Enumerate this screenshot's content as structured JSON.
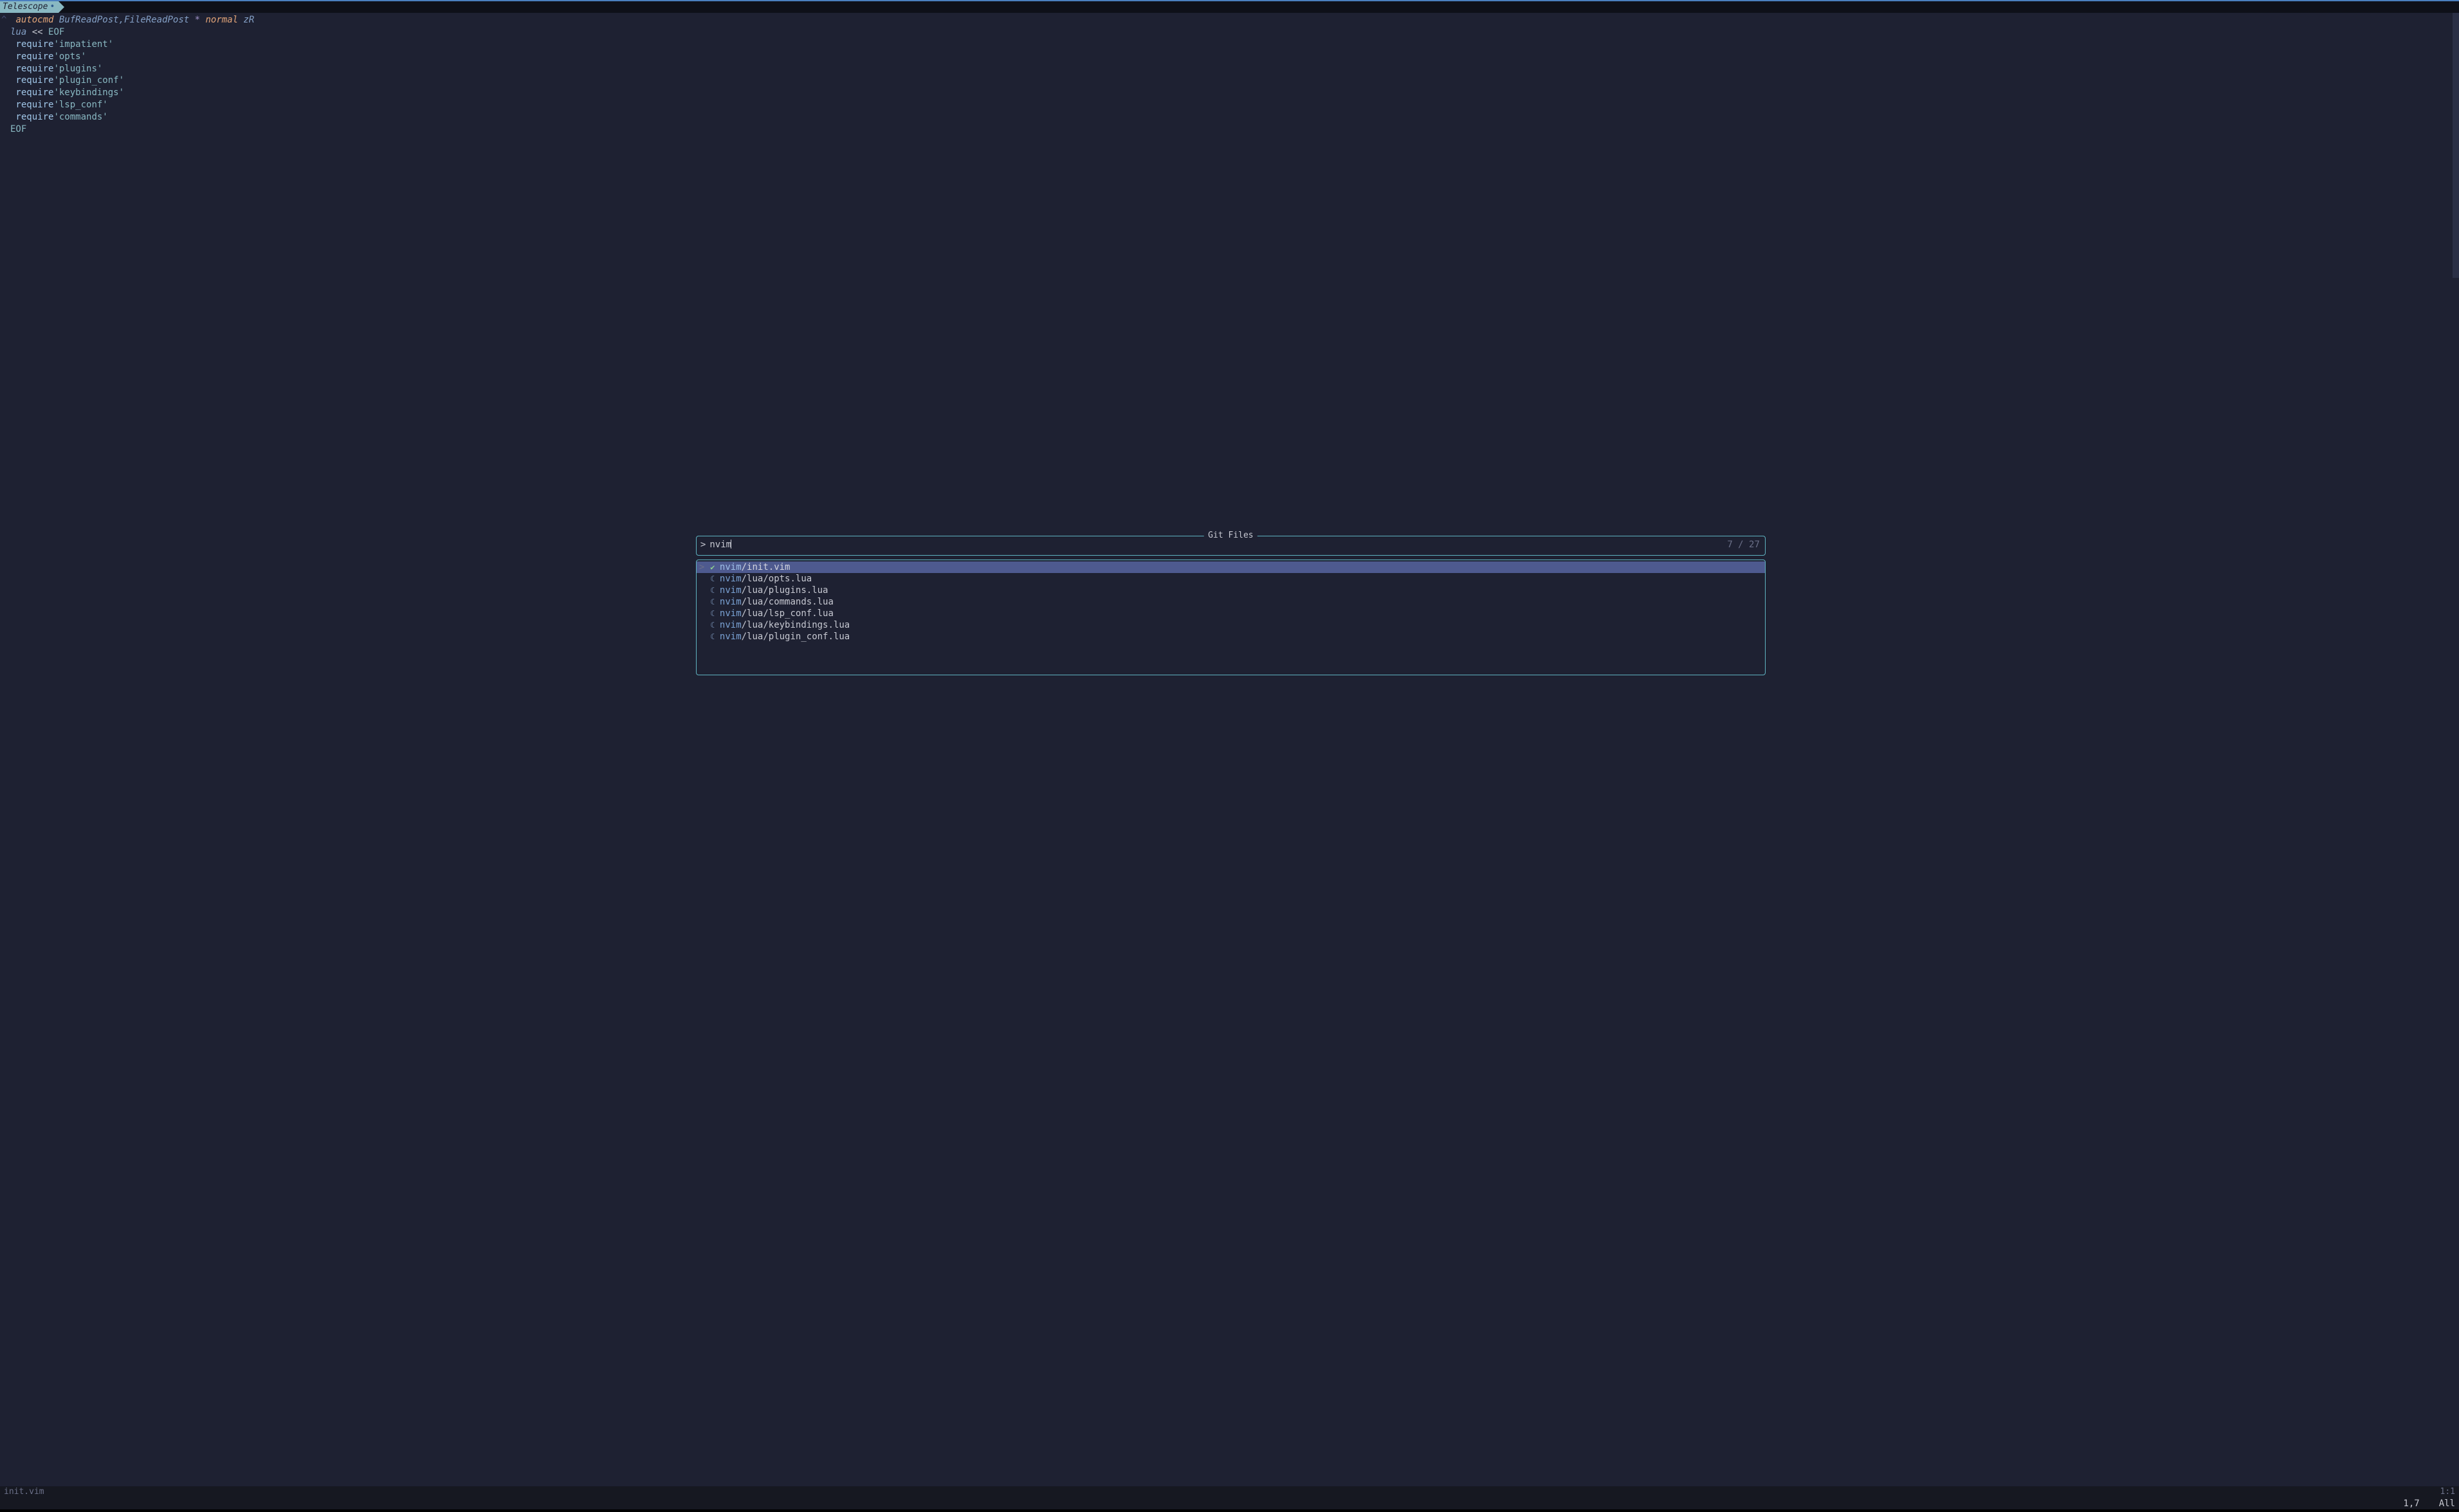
{
  "tabline": {
    "tabs": [
      {
        "label": "Telescope",
        "modified_mark": "•"
      }
    ]
  },
  "buffer": {
    "lines": [
      {
        "gutter": "^",
        "segments": [
          {
            "t": " ",
            "c": ""
          },
          {
            "t": "autocmd",
            "c": "kw-orange"
          },
          {
            "t": " BufReadPost,FileReadPost ",
            "c": "kw-blue"
          },
          {
            "t": "*",
            "c": "const"
          },
          {
            "t": " ",
            "c": ""
          },
          {
            "t": "normal",
            "c": "kw-orange"
          },
          {
            "t": " zR",
            "c": "kw-blue"
          }
        ]
      },
      {
        "gutter": " ",
        "segments": [
          {
            "t": "lua",
            "c": "kw-blue"
          },
          {
            "t": " << ",
            "c": "op"
          },
          {
            "t": "EOF",
            "c": "heredoc"
          }
        ]
      },
      {
        "gutter": " ",
        "segments": [
          {
            "t": " require",
            "c": "fn"
          },
          {
            "t": "'impatient'",
            "c": "str"
          }
        ]
      },
      {
        "gutter": " ",
        "segments": [
          {
            "t": " require",
            "c": "fn"
          },
          {
            "t": "'opts'",
            "c": "str"
          }
        ]
      },
      {
        "gutter": " ",
        "segments": [
          {
            "t": " require",
            "c": "fn"
          },
          {
            "t": "'plugins'",
            "c": "str"
          }
        ]
      },
      {
        "gutter": " ",
        "segments": [
          {
            "t": " require",
            "c": "fn"
          },
          {
            "t": "'plugin_conf'",
            "c": "str"
          }
        ]
      },
      {
        "gutter": " ",
        "segments": [
          {
            "t": " require",
            "c": "fn"
          },
          {
            "t": "'keybindings'",
            "c": "str"
          }
        ]
      },
      {
        "gutter": " ",
        "segments": [
          {
            "t": " require",
            "c": "fn"
          },
          {
            "t": "'lsp_conf'",
            "c": "str"
          }
        ]
      },
      {
        "gutter": " ",
        "segments": [
          {
            "t": " require",
            "c": "fn"
          },
          {
            "t": "'commands'",
            "c": "str"
          }
        ]
      },
      {
        "gutter": "",
        "segments": [
          {
            "t": "EOF",
            "c": "heredoc"
          }
        ]
      }
    ]
  },
  "telescope": {
    "title": "Git Files",
    "prompt_prefix": ">",
    "query": "nvim",
    "count": "7 / 27",
    "results": [
      {
        "selected": true,
        "icon": "vim",
        "match": "nvim",
        "rest": "/init.vim"
      },
      {
        "selected": false,
        "icon": "lua",
        "match": "nvim",
        "rest": "/lua/opts.lua"
      },
      {
        "selected": false,
        "icon": "lua",
        "match": "nvim",
        "rest": "/lua/plugins.lua"
      },
      {
        "selected": false,
        "icon": "lua",
        "match": "nvim",
        "rest": "/lua/commands.lua"
      },
      {
        "selected": false,
        "icon": "lua",
        "match": "nvim",
        "rest": "/lua/lsp_conf.lua"
      },
      {
        "selected": false,
        "icon": "lua",
        "match": "nvim",
        "rest": "/lua/keybindings.lua"
      },
      {
        "selected": false,
        "icon": "lua",
        "match": "nvim",
        "rest": "/lua/plugin_conf.lua"
      }
    ],
    "icons": {
      "vim": "✔",
      "lua": "☾"
    }
  },
  "statusline": {
    "filename": "init.vim",
    "ruler_top": "1:1",
    "ruler_bottom": "1,7",
    "position": "All"
  }
}
